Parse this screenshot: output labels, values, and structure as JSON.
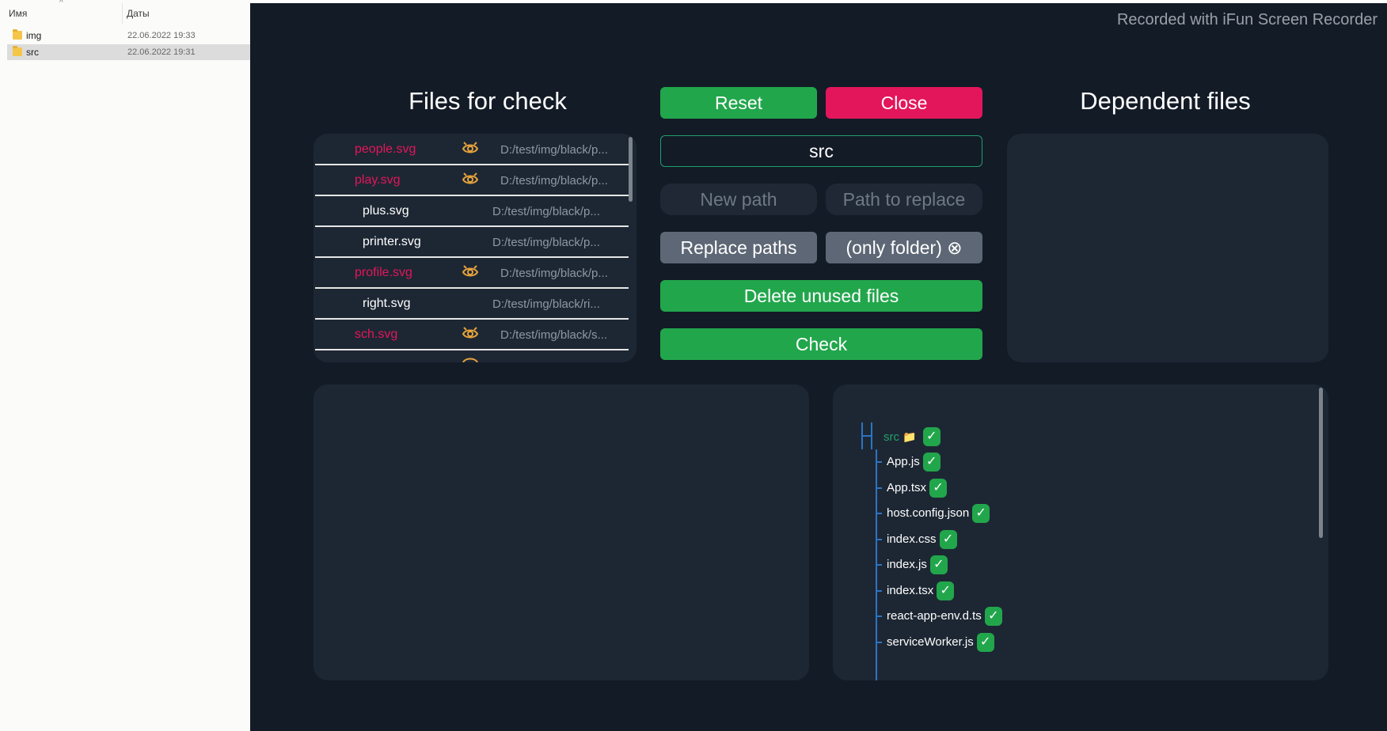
{
  "explorer": {
    "col_name": "Имя",
    "col_date": "Даты",
    "rows": [
      {
        "name": "img",
        "date": "22.06.2022 19:33"
      },
      {
        "name": "src",
        "date": "22.06.2022 19:31"
      }
    ]
  },
  "app": {
    "watermark": "Recorded with iFun Screen Recorder",
    "files_title": "Files for check",
    "dependent_title": "Dependent files",
    "buttons": {
      "reset": "Reset",
      "close": "Close",
      "new_path": "New path",
      "path_to_replace": "Path to replace",
      "replace_paths": "Replace paths",
      "only_folder": "(only folder) ⊗",
      "delete_unused": "Delete unused files",
      "check": "Check"
    },
    "folder_input": "src",
    "files": [
      {
        "name": "people.svg",
        "path": "D:/test/img/black/p...",
        "unused": true
      },
      {
        "name": "play.svg",
        "path": "D:/test/img/black/p...",
        "unused": true
      },
      {
        "name": "plus.svg",
        "path": "D:/test/img/black/p...",
        "unused": false
      },
      {
        "name": "printer.svg",
        "path": "D:/test/img/black/p...",
        "unused": false
      },
      {
        "name": "profile.svg",
        "path": "D:/test/img/black/p...",
        "unused": true
      },
      {
        "name": "right.svg",
        "path": "D:/test/img/black/ri...",
        "unused": false
      },
      {
        "name": "sch.svg",
        "path": "D:/test/img/black/s...",
        "unused": true
      }
    ],
    "tree": {
      "root": "src",
      "root_icon": "📁",
      "check_mark": "✓",
      "items": [
        "App.js",
        "App.tsx",
        "host.config.json",
        "index.css",
        "index.js",
        "index.tsx",
        "react-app-env.d.ts",
        "serviceWorker.js"
      ]
    },
    "colors": {
      "background": "#131b27",
      "panel": "#1d2733",
      "green": "#22a64c",
      "red": "#e3165b",
      "eye_icon": "#e6a23c"
    }
  }
}
